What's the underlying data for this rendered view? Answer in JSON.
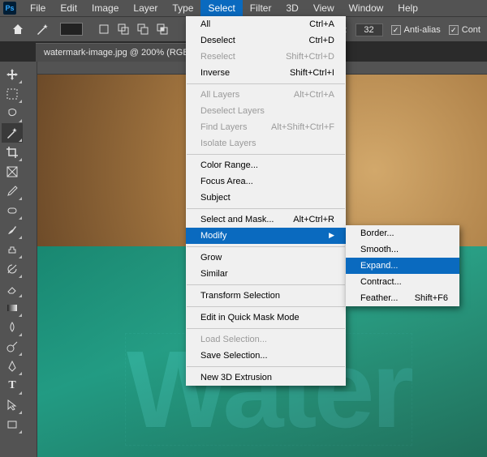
{
  "menubar": {
    "items": [
      "File",
      "Edit",
      "Image",
      "Layer",
      "Type",
      "Select",
      "Filter",
      "3D",
      "View",
      "Window",
      "Help"
    ],
    "active_index": 5
  },
  "options_bar": {
    "tolerance_label": "rance:",
    "tolerance_value": "32",
    "anti_alias_label": "Anti-alias",
    "anti_alias_checked": true,
    "cont_label": "Cont"
  },
  "tab": {
    "title": "watermark-image.jpg @ 200% (RGB...",
    "close": "×"
  },
  "select_menu": {
    "groups": [
      [
        {
          "label": "All",
          "shortcut": "Ctrl+A",
          "disabled": false
        },
        {
          "label": "Deselect",
          "shortcut": "Ctrl+D",
          "disabled": false
        },
        {
          "label": "Reselect",
          "shortcut": "Shift+Ctrl+D",
          "disabled": true
        },
        {
          "label": "Inverse",
          "shortcut": "Shift+Ctrl+I",
          "disabled": false
        }
      ],
      [
        {
          "label": "All Layers",
          "shortcut": "Alt+Ctrl+A",
          "disabled": true
        },
        {
          "label": "Deselect Layers",
          "shortcut": "",
          "disabled": true
        },
        {
          "label": "Find Layers",
          "shortcut": "Alt+Shift+Ctrl+F",
          "disabled": true
        },
        {
          "label": "Isolate Layers",
          "shortcut": "",
          "disabled": true
        }
      ],
      [
        {
          "label": "Color Range...",
          "shortcut": "",
          "disabled": false
        },
        {
          "label": "Focus Area...",
          "shortcut": "",
          "disabled": false
        },
        {
          "label": "Subject",
          "shortcut": "",
          "disabled": false
        }
      ],
      [
        {
          "label": "Select and Mask...",
          "shortcut": "Alt+Ctrl+R",
          "disabled": false
        },
        {
          "label": "Modify",
          "shortcut": "",
          "disabled": false,
          "submenu": true,
          "hover": true
        }
      ],
      [
        {
          "label": "Grow",
          "shortcut": "",
          "disabled": false
        },
        {
          "label": "Similar",
          "shortcut": "",
          "disabled": false
        }
      ],
      [
        {
          "label": "Transform Selection",
          "shortcut": "",
          "disabled": false
        }
      ],
      [
        {
          "label": "Edit in Quick Mask Mode",
          "shortcut": "",
          "disabled": false
        }
      ],
      [
        {
          "label": "Load Selection...",
          "shortcut": "",
          "disabled": true
        },
        {
          "label": "Save Selection...",
          "shortcut": "",
          "disabled": false
        }
      ],
      [
        {
          "label": "New 3D Extrusion",
          "shortcut": "",
          "disabled": false
        }
      ]
    ]
  },
  "modify_submenu": {
    "items": [
      {
        "label": "Border...",
        "shortcut": "",
        "hover": false
      },
      {
        "label": "Smooth...",
        "shortcut": "",
        "hover": false
      },
      {
        "label": "Expand...",
        "shortcut": "",
        "hover": true
      },
      {
        "label": "Contract...",
        "shortcut": "",
        "hover": false
      },
      {
        "label": "Feather...",
        "shortcut": "Shift+F6",
        "hover": false
      }
    ]
  },
  "canvas": {
    "watermark_text": "Water"
  }
}
